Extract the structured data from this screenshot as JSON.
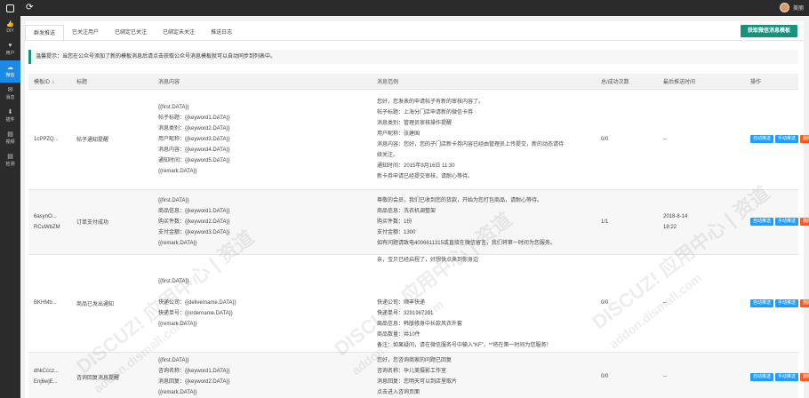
{
  "user": {
    "name": "美丽"
  },
  "sidebar": {
    "items": [
      {
        "label": "DIY",
        "icon": "thumb-icon"
      },
      {
        "label": "用户",
        "icon": "heart-icon"
      },
      {
        "label": "微信",
        "icon": "wechat-icon"
      },
      {
        "label": "消息",
        "icon": "message-icon"
      },
      {
        "label": "插件",
        "icon": "download-icon"
      },
      {
        "label": "视频",
        "icon": "document-icon"
      },
      {
        "label": "检测",
        "icon": "document-icon"
      }
    ]
  },
  "tabs": [
    "群发推送",
    "已关注用户",
    "已绑定已关注",
    "已绑定未关注",
    "推送日志"
  ],
  "fetch_button": "获取微信消息模板",
  "notice": "温馨提示：当您在公众号添加了新的模板消息后请点击获取公众号消息模板就可以自动同步到列表中。",
  "table": {
    "headers": [
      "模板ID",
      "标题",
      "消息内容",
      "消息范例",
      "总/成功次数",
      "最后推送时间",
      "操作"
    ],
    "rows": [
      {
        "id": [
          "1cPPZQ..."
        ],
        "title": "帖子通知提醒",
        "content": [
          "{{first.DATA}}",
          "帖子标题：{{keyword1.DATA}}",
          "消息类别：{{keyword2.DATA}}",
          "用户昵称：{{keyword3.DATA}}",
          "消息内容：{{keyword4.DATA}}",
          "通知时间：{{keyword5.DATA}}",
          "{{remark.DATA}}"
        ],
        "example": [
          "您好，您发表的申请帖子有新的审核内容了。",
          "帖子标题：上海分门店申请新的微信卡券",
          "消息类别：管理员审核操作提醒",
          "用户昵称：张建国",
          "消息内容：您好，您的子门店新卡券内容已经由管理员上传提交，新的动态请待",
          "续关注。",
          "通知时间：2015年9月16日 11:30",
          "新卡券申请已经提交审核，请耐心等待。"
        ],
        "count": "0/0",
        "time": [
          "--"
        ]
      },
      {
        "id": [
          "6asynO...",
          "RCuWbZM"
        ],
        "title": "订单支付成功",
        "content": [
          "{{first.DATA}}",
          "商品信息：{{keyword1.DATA}}",
          "购买件数：{{keyword2.DATA}}",
          "支付金额：{{keyword3.DATA}}",
          "{{remark.DATA}}"
        ],
        "example": [
          "尊敬的会员，我们已收到您的货款，开始为您打包商品，请耐心等待。",
          "商品信息：洗衣机调整架",
          "购买件数：1份",
          "支付金额：1300",
          "如有问题请致电4006611315或直接在微信留言，我们将第一时间为您服务。"
        ],
        "count": "1/1",
        "time": [
          "2018-8-14",
          "18:22"
        ]
      },
      {
        "id": [
          "BKHMb..."
        ],
        "title": "商品已发出通知",
        "content": [
          "{{first.DATA}}",
          "",
          "快递公司：{{delivername.DATA}}",
          "快递单号：{{ordername.DATA}}",
          "{{remark.DATA}}"
        ],
        "example": [
          "亲，宝贝已经启程了，好想快点来到你身边",
          "",
          "",
          "",
          "快递公司：顺丰快递",
          "快递单号：3291987391",
          "商品信息：韩版修身中长款风衣外套",
          "商品数量：共10件",
          "备注：如果疑问，请在微信服务号中输入“KF”，**将在第一时间为您服务！"
        ],
        "count": "0/0",
        "time": [
          "--"
        ]
      },
      {
        "id": [
          "dhkCccz...",
          "Enj6wjE..."
        ],
        "title": "咨询回复消息提醒",
        "content": [
          "{{first.DATA}}",
          "咨询名称：{{keyword1.DATA}}",
          "消息回复：{{keyword2.DATA}}",
          "{{remark.DATA}}"
        ],
        "example": [
          "您好，您咨询商家的问题已回复",
          "咨询名称：孕儿美摄影工作室",
          "消息回复：您明天可以到店里取片",
          "点击进入咨询页面"
        ],
        "count": "0/0",
        "time": [
          "--"
        ]
      }
    ],
    "ops": {
      "auto": "自动推送",
      "manual": "手动推送",
      "delete": "删除"
    }
  },
  "watermark": {
    "text": "DISCUZ! 应用中心 | 资道",
    "sub": "addon.dismall.com"
  }
}
